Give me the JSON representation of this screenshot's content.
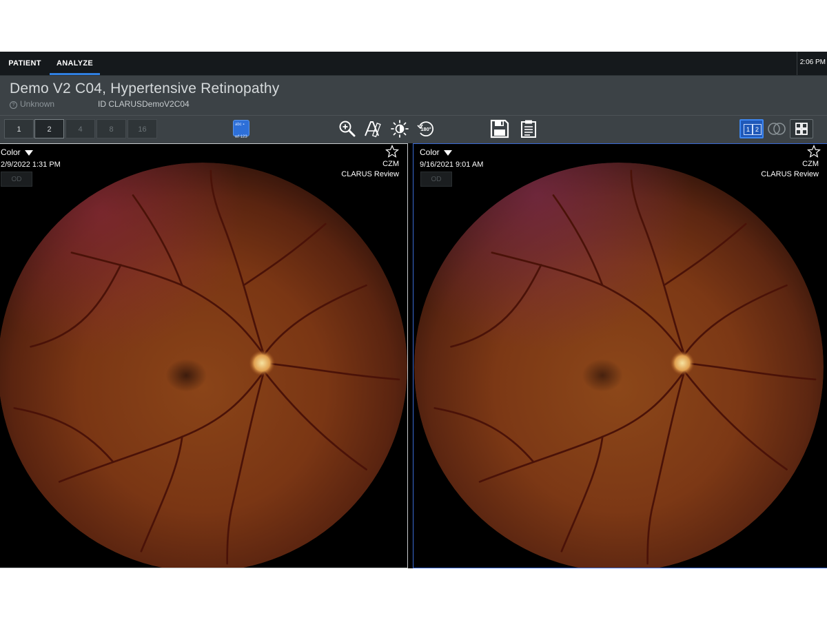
{
  "nav": {
    "tabs": [
      {
        "label": "PATIENT"
      },
      {
        "label": "ANALYZE"
      }
    ],
    "clock": "2:06 PM"
  },
  "patient": {
    "name": "Demo V2 C04, Hypertensive Retinopathy",
    "status": "Unknown",
    "id": "ID CLARUSDemoV2C04"
  },
  "toolbar": {
    "layout_buttons": [
      "1",
      "2",
      "4",
      "8",
      "16"
    ],
    "active_layout": "2",
    "annotation_icon_text": [
      "abc",
      "wf",
      "123"
    ],
    "rotate_label": "180°",
    "split_labels": [
      "1",
      "2"
    ],
    "icons": [
      "zoom-in-icon",
      "measure-icon",
      "brightness-icon",
      "rotate-180-icon",
      "save-icon",
      "clipboard-icon",
      "split-view-icon",
      "overlay-icon",
      "grid-view-icon"
    ],
    "accent": "#2f7fe0"
  },
  "panels": [
    {
      "mode": "Color",
      "date": "2/9/2022 1:31 PM",
      "eye": "OD",
      "brand": "CZM",
      "product": "CLARUS Review",
      "selected": false
    },
    {
      "mode": "Color",
      "date": "9/16/2021 9:01 AM",
      "eye": "OD",
      "brand": "CZM",
      "product": "CLARUS Review",
      "selected": true
    }
  ]
}
